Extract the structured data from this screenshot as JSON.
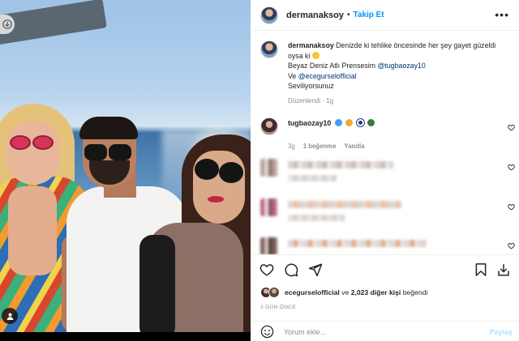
{
  "post": {
    "username": "dermanaksoy",
    "separator": "•",
    "follow_label": "Takip Et",
    "more_icon": "more-options-icon",
    "caption": {
      "line1": "Denizde ki tehlike öncesinde her şey gayet güzeldi",
      "line2": "oysa ki",
      "line3_prefix": "Beyaz Deniz Atlı Prensesim ",
      "mention1": "@tugbaozay10",
      "line4_prefix": "Ve ",
      "mention2": "@ecegurselofficial",
      "line5": "Seviliyorsunuz",
      "edited": "Düzenlendi",
      "dot": "·",
      "age": "1g"
    },
    "comments": [
      {
        "username": "tugbaozay10",
        "age": "3g",
        "likes": "1 beğenme",
        "reply": "Yanıtla"
      }
    ],
    "liked_by": {
      "user": "ecegurselofficial",
      "connector": "ve",
      "others": "2,023 diğer kişi",
      "suffix": "beğendi"
    },
    "time_ago": "3 GÜN ÖNCE",
    "comment_placeholder": "Yorum ekle...",
    "post_button": "Paylaş"
  },
  "colors": {
    "accent": "#0095f6",
    "mention": "#00376b",
    "muted": "#8e8e8e",
    "post_disabled": "#b2dffc"
  }
}
